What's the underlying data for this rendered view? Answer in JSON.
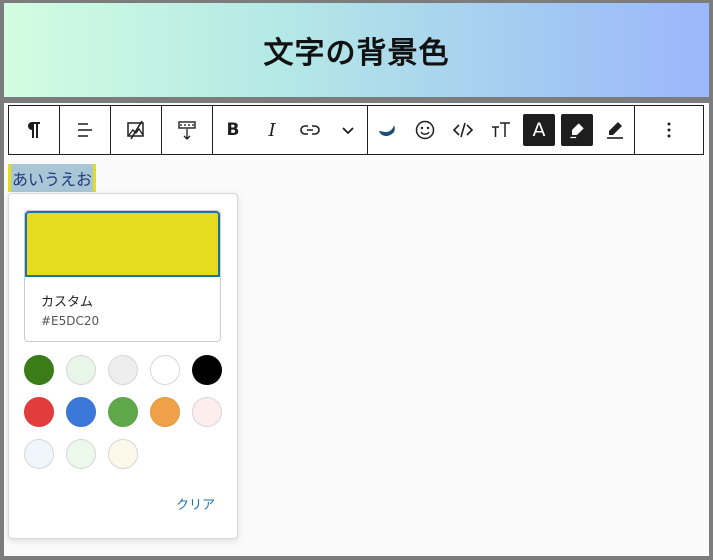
{
  "header": {
    "title": "文字の背景色"
  },
  "toolbar": {
    "italic_label": "I",
    "bold_label": "B",
    "text_color_label": "A"
  },
  "paragraph": {
    "text": "あいうえお"
  },
  "color_picker": {
    "custom_name": "カスタム",
    "custom_hex": "#E5DC20",
    "custom_color": "#e5dc20",
    "swatches": [
      "#3a7d18",
      "#e8f5e9",
      "#eeeeee",
      "#ffffff",
      "#000000",
      "#e33c3c",
      "#3b78d8",
      "#5fa84a",
      "#f0a048",
      "#fdeded",
      "#f0f6fb",
      "#ecf8ec",
      "#fdf8ea"
    ],
    "clear_label": "クリア"
  }
}
